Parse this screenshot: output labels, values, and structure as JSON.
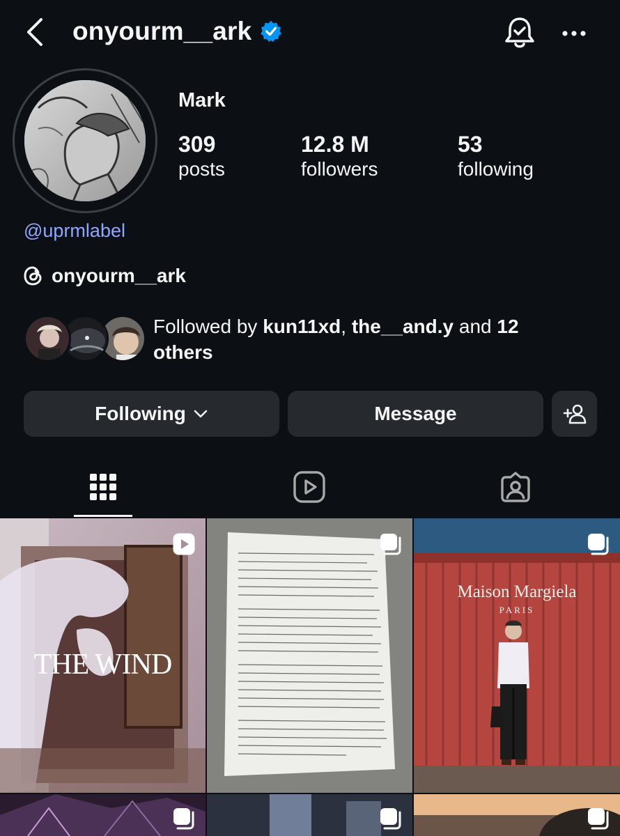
{
  "profile": {
    "username": "onyourm__ark",
    "display_name": "Mark",
    "link": "@uprmlabel",
    "threads_handle": "onyourm__ark"
  },
  "stats": {
    "posts": {
      "value": "309",
      "label": "posts"
    },
    "followers": {
      "value": "12.8 M",
      "label": "followers"
    },
    "following": {
      "value": "53",
      "label": "following"
    }
  },
  "followed_by": {
    "prefix": "Followed by ",
    "user1": "kun11xd",
    "separator": ", ",
    "user2": "the__and.y",
    "middle": " and ",
    "count": "12",
    "suffix": "others"
  },
  "actions": {
    "following_label": "Following",
    "message_label": "Message"
  },
  "grid": {
    "tile1_text": "THE WIND",
    "tile3_brand": "Maison Margiela",
    "tile3_city": "PARIS"
  },
  "icons": {
    "back": "chevron-left-icon",
    "verified": "verified-badge-icon",
    "bell": "bell-check-icon",
    "more": "more-horizontal-icon",
    "threads": "threads-icon",
    "add_user": "add-user-icon",
    "grid_tab": "grid-icon",
    "reels_tab": "reels-icon",
    "tagged_tab": "tagged-icon",
    "carousel": "carousel-icon",
    "reel": "reel-icon"
  },
  "colors": {
    "background": "#0c1014",
    "button": "#26292e",
    "link": "#8fa7ff",
    "verified": "#0095f6"
  }
}
